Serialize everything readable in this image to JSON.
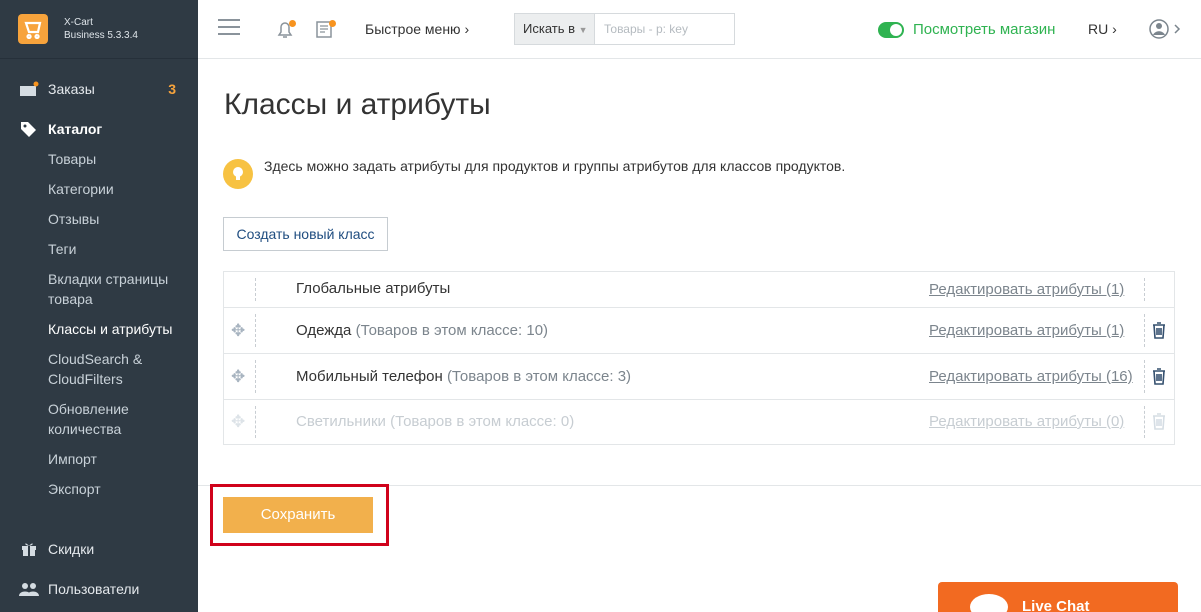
{
  "app": {
    "name_line1": "X-Cart",
    "name_line2": "Business 5.3.3.4"
  },
  "sidebar": {
    "orders": {
      "label": "Заказы",
      "badge": "3"
    },
    "catalog": {
      "label": "Каталог"
    },
    "catalog_items": [
      "Товары",
      "Категории",
      "Отзывы",
      "Теги",
      "Вкладки страницы товара",
      "Классы и атрибуты",
      "CloudSearch & CloudFilters",
      "Обновление количества",
      "Импорт",
      "Экспорт"
    ],
    "discounts": {
      "label": "Скидки"
    },
    "users": {
      "label": "Пользователи"
    }
  },
  "topbar": {
    "quick_menu": "Быстрое меню",
    "search_btn": "Искать в",
    "search_placeholder": "Товары - p: key",
    "view_store": "Посмотреть магазин",
    "lang": "RU"
  },
  "page": {
    "title": "Классы и атрибуты",
    "hint": "Здесь можно задать атрибуты для продуктов и группы атрибутов для классов продуктов.",
    "create_button": "Создать новый класс",
    "rows": [
      {
        "name": "Глобальные атрибуты",
        "count": "",
        "edit": "Редактировать атрибуты (1)"
      },
      {
        "name": "Одежда",
        "count": "(Товаров в этом классе: 10)",
        "edit": "Редактировать атрибуты (1)"
      },
      {
        "name": "Мобильный телефон",
        "count": "(Товаров в этом классе: 3)",
        "edit": "Редактировать атрибуты (16)"
      },
      {
        "name": "Светильники",
        "count": "(Товаров в этом классе: 0)",
        "edit": "Редактировать атрибуты (0)"
      }
    ],
    "save_button": "Сохранить"
  },
  "livechat": {
    "label": "Live Chat"
  }
}
